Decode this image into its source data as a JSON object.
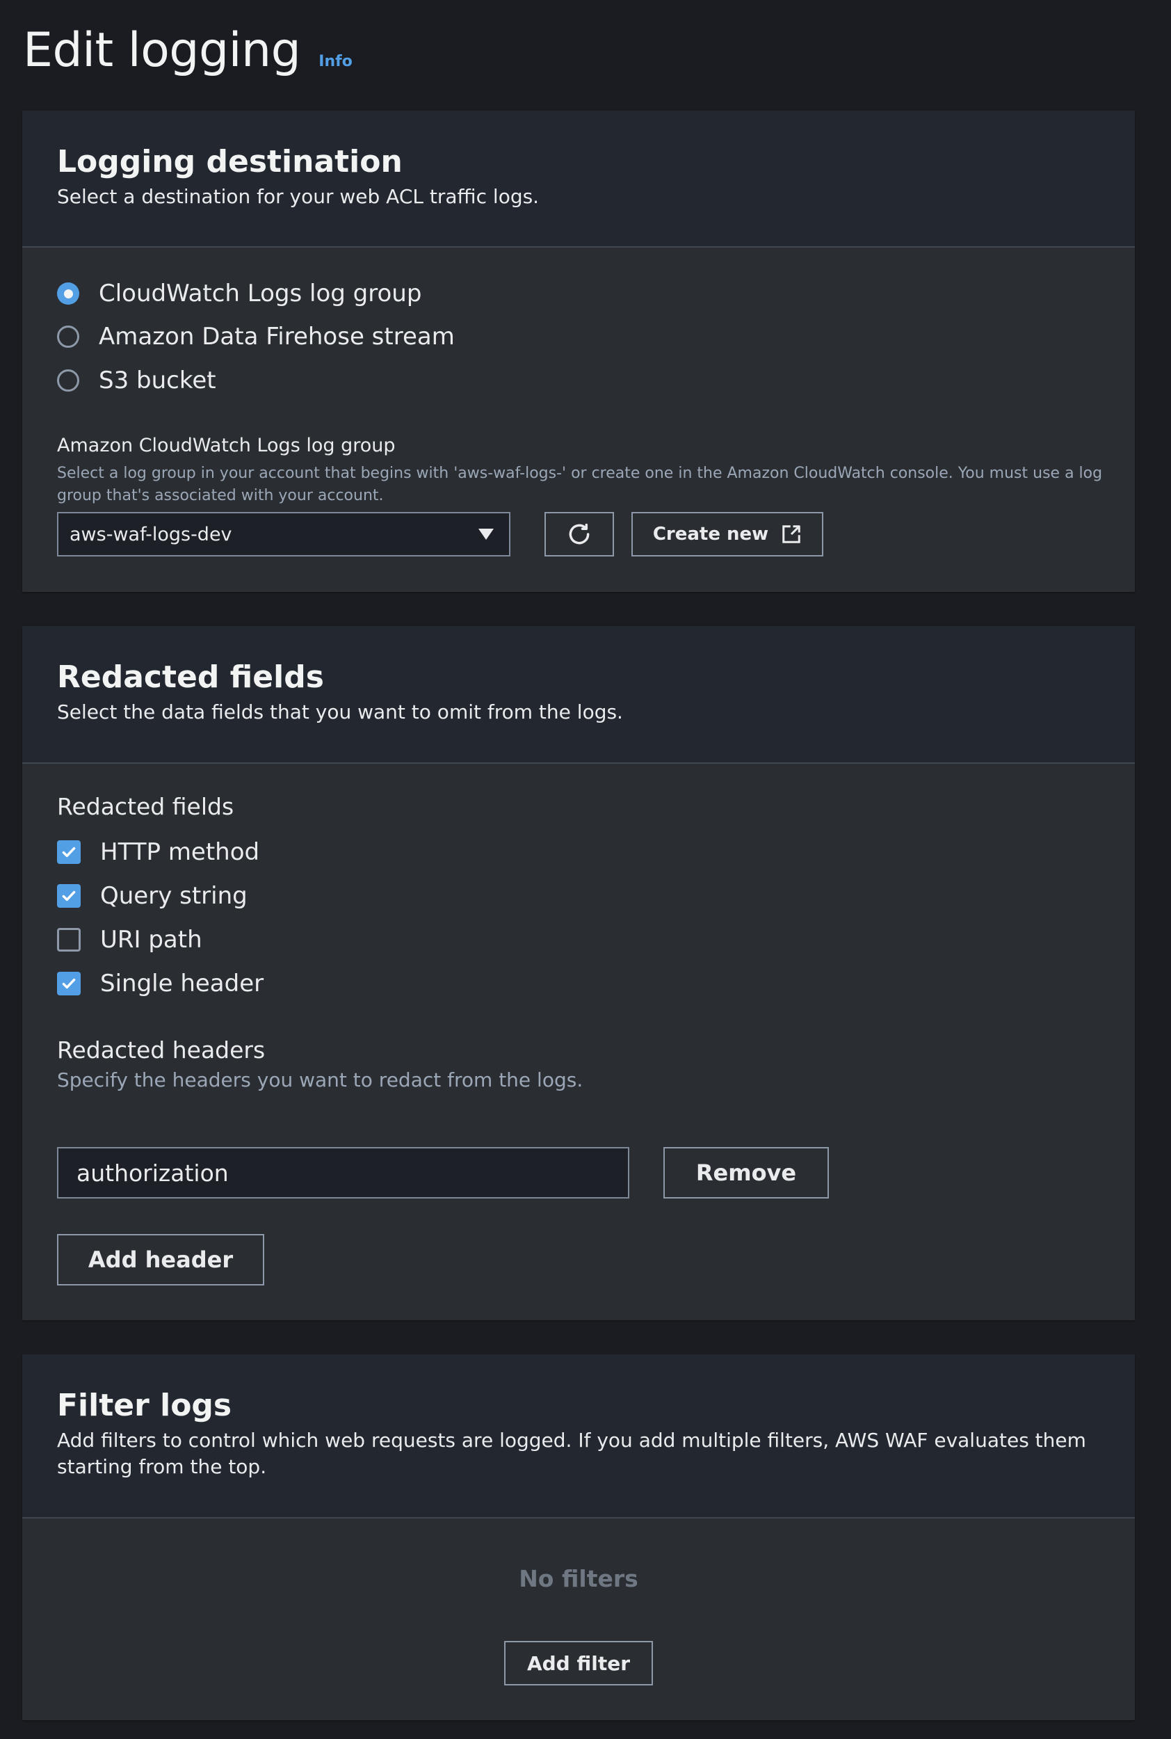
{
  "page": {
    "title": "Edit logging",
    "info_link": "Info"
  },
  "logging_destination": {
    "title": "Logging destination",
    "description": "Select a destination for your web ACL traffic logs.",
    "options": [
      {
        "label": "CloudWatch Logs log group",
        "selected": true
      },
      {
        "label": "Amazon Data Firehose stream",
        "selected": false
      },
      {
        "label": "S3 bucket",
        "selected": false
      }
    ],
    "log_group_label": "Amazon CloudWatch Logs log group",
    "log_group_description": "Select a log group in your account that begins with 'aws-waf-logs-' or create one in the Amazon CloudWatch console. You must use a log group that's associated with your account.",
    "log_group_value": "aws-waf-logs-dev",
    "create_new_label": "Create new"
  },
  "redacted_fields": {
    "title": "Redacted fields",
    "description": "Select the data fields that you want to omit from the logs.",
    "group_label": "Redacted fields",
    "fields": [
      {
        "label": "HTTP method",
        "checked": true
      },
      {
        "label": "Query string",
        "checked": true
      },
      {
        "label": "URI path",
        "checked": false
      },
      {
        "label": "Single header",
        "checked": true
      }
    ],
    "headers_label": "Redacted headers",
    "headers_description": "Specify the headers you want to redact from the logs.",
    "header_value": "authorization",
    "remove_label": "Remove",
    "add_header_label": "Add header"
  },
  "filter_logs": {
    "title": "Filter logs",
    "description": "Add filters to control which web requests are logged. If you add multiple filters, AWS WAF evaluates them starting from the top.",
    "empty_text": "No filters",
    "add_filter_label": "Add filter"
  },
  "colors": {
    "background": "#1a1c21",
    "card": "#2a2e33",
    "card_header": "#232730",
    "accent": "#539fe5",
    "text": "#e9ebed",
    "muted_text": "#9ba7b6"
  }
}
